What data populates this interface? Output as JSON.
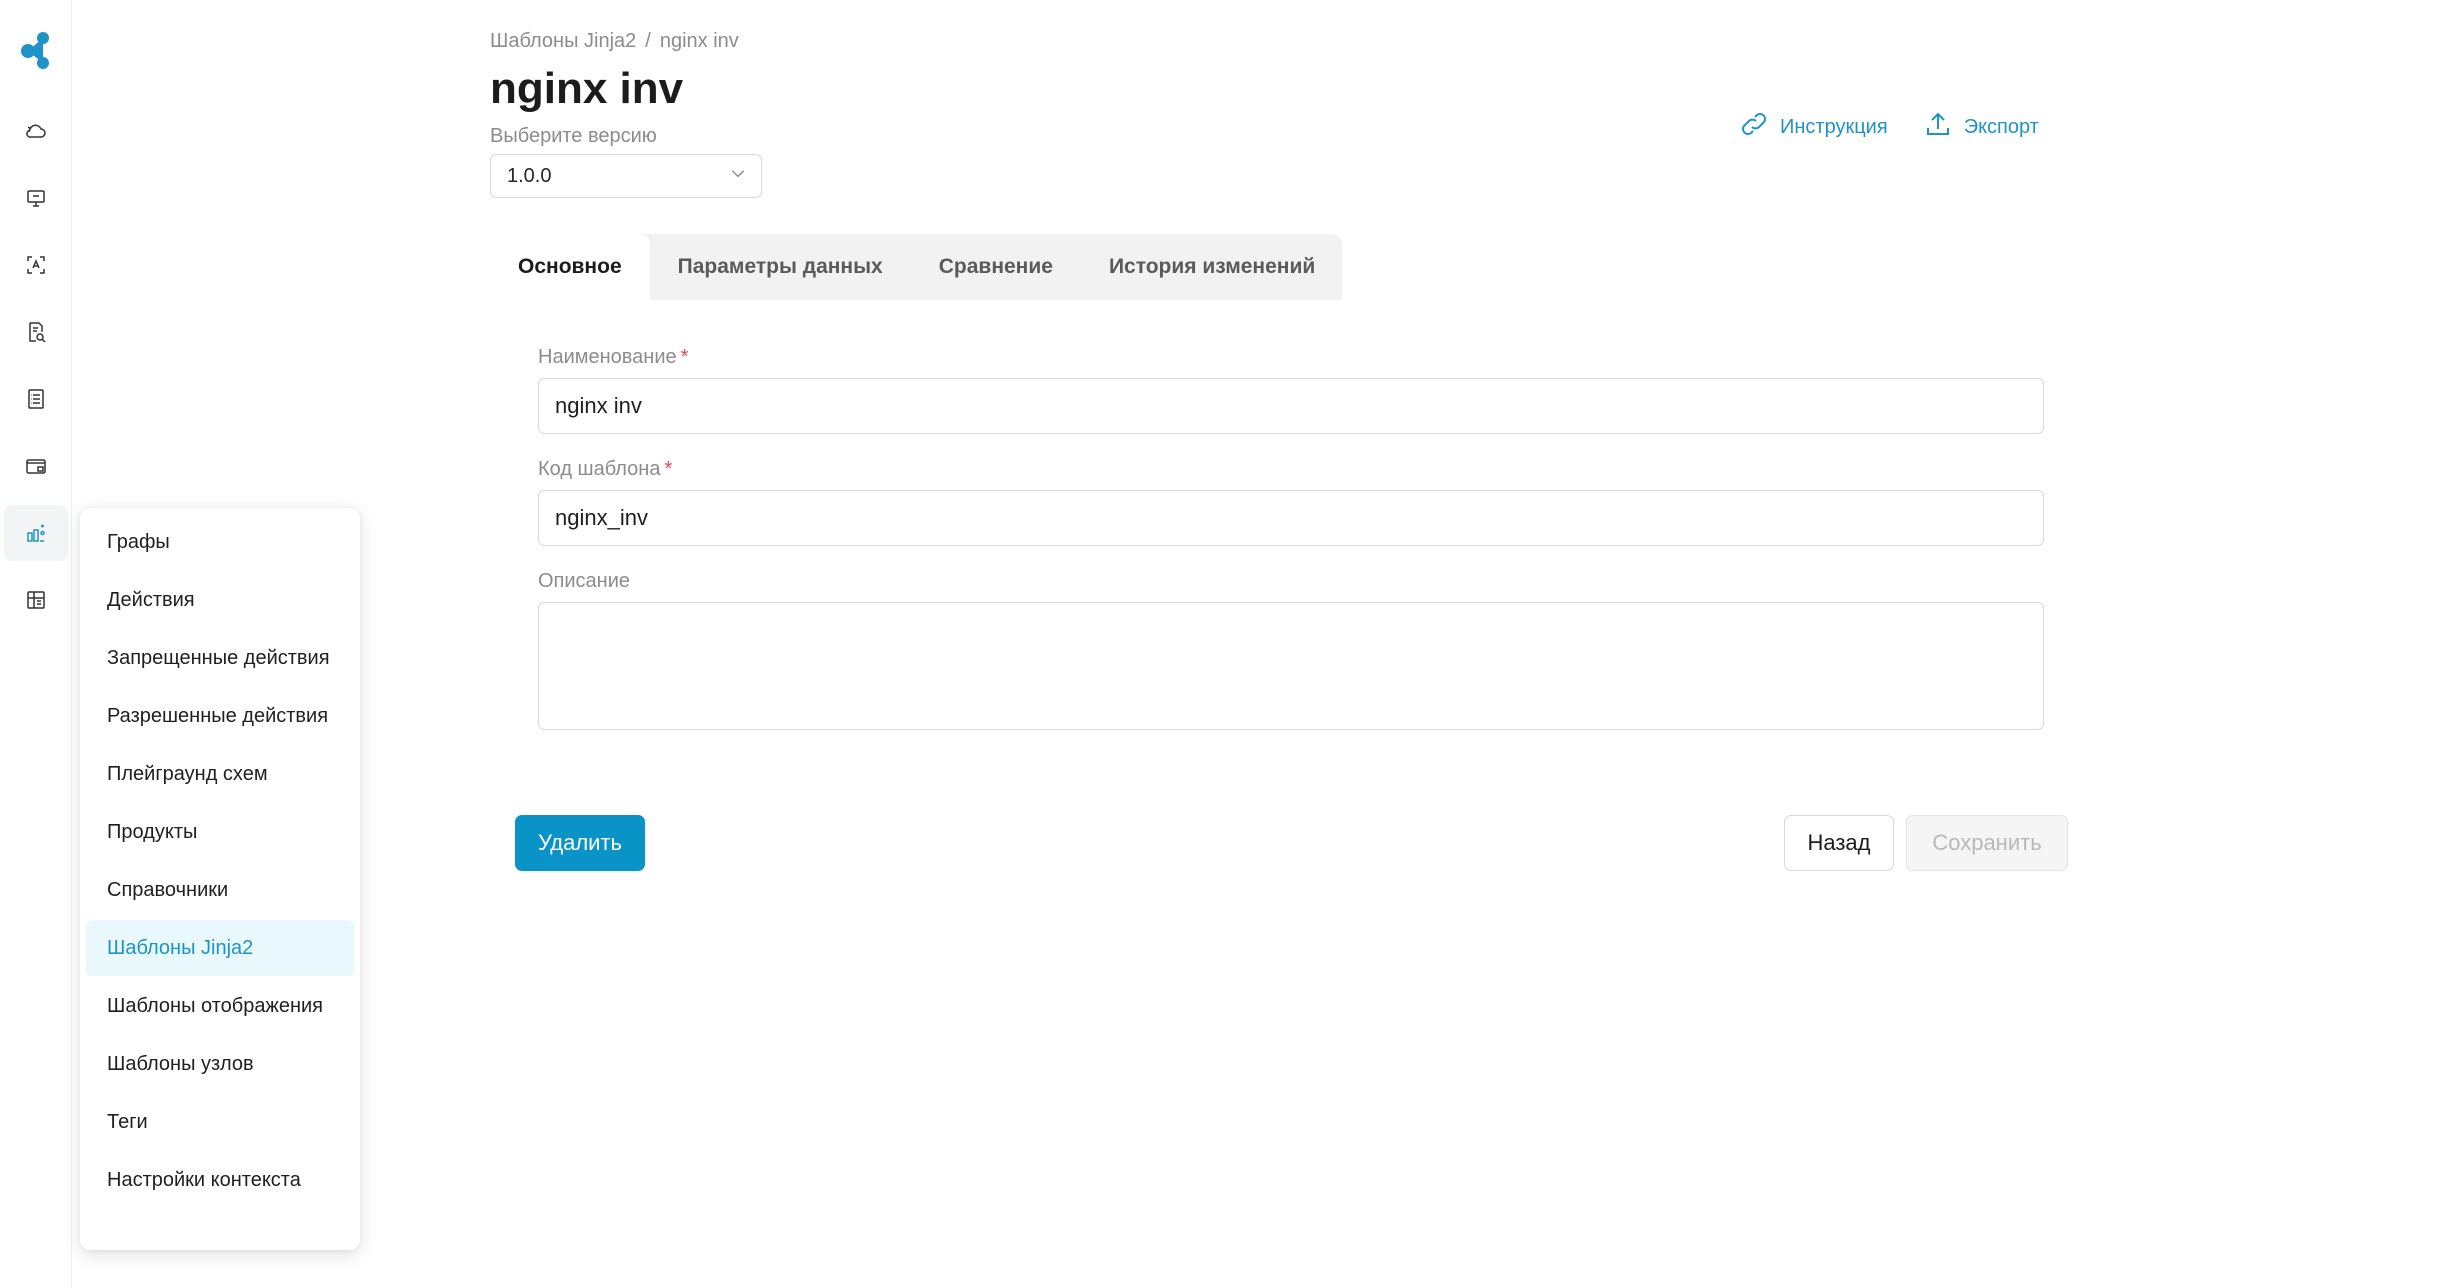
{
  "breadcrumb": {
    "parent": "Шаблоны Jinja2",
    "separator": "/",
    "current": "nginx inv"
  },
  "page": {
    "title": "nginx inv"
  },
  "version": {
    "label": "Выберите версию",
    "value": "1.0.0"
  },
  "header_actions": {
    "instructions": "Инструкция",
    "export": "Экспорт"
  },
  "tabs": [
    {
      "label": "Основное",
      "active": true
    },
    {
      "label": "Параметры данных",
      "active": false
    },
    {
      "label": "Сравнение",
      "active": false
    },
    {
      "label": "История изменений",
      "active": false
    }
  ],
  "form": {
    "name_label": "Наименование",
    "name_value": "nginx inv",
    "code_label": "Код шаблона",
    "code_value": "nginx_inv",
    "description_label": "Описание",
    "required_mark": "*"
  },
  "buttons": {
    "delete": "Удалить",
    "back": "Назад",
    "save": "Сохранить"
  },
  "rail_icons": [
    "cloud-icon",
    "monitor-icon",
    "scan-text-icon",
    "search-document-icon",
    "list-document-icon",
    "wallet-icon",
    "graph-icon",
    "grid-icon"
  ],
  "menu": {
    "items": [
      {
        "label": "Графы",
        "active": false
      },
      {
        "label": "Действия",
        "active": false
      },
      {
        "label": "Запрещенные действия",
        "active": false
      },
      {
        "label": "Разрешенные действия",
        "active": false
      },
      {
        "label": "Плейграунд схем",
        "active": false
      },
      {
        "label": "Продукты",
        "active": false
      },
      {
        "label": "Справочники",
        "active": false
      },
      {
        "label": "Шаблоны Jinja2",
        "active": true
      },
      {
        "label": "Шаблоны отображения",
        "active": false
      },
      {
        "label": "Шаблоны узлов",
        "active": false
      },
      {
        "label": "Теги",
        "active": false
      },
      {
        "label": "Настройки контекста",
        "active": false
      }
    ]
  },
  "colors": {
    "accent": "#1f93c9",
    "primary_button": "#0a93c7",
    "required": "#e5484d",
    "menu_active_bg": "#e9f8fc"
  }
}
